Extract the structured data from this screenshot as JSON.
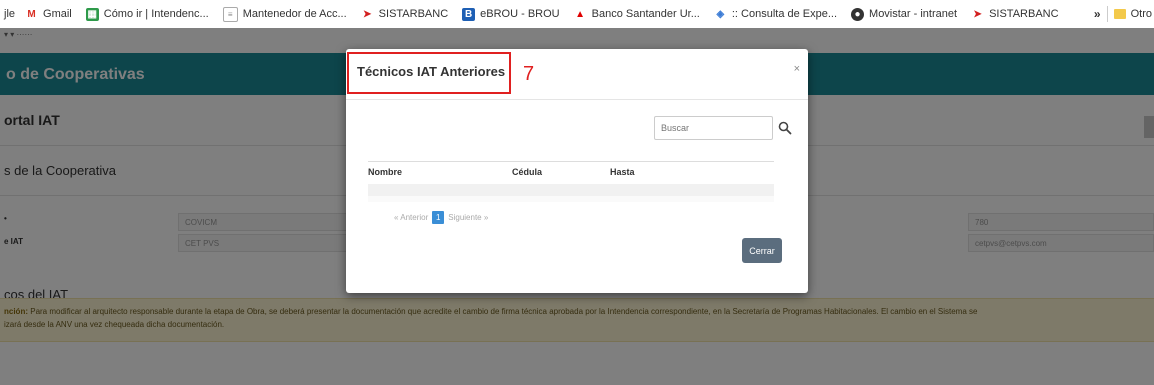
{
  "bookmarks": {
    "items": [
      {
        "label": "jle",
        "icon": "truncated-bookmark"
      },
      {
        "label": "Gmail",
        "icon": "gmail-icon"
      },
      {
        "label": "Cómo ir | Intendenc...",
        "icon": "map-icon"
      },
      {
        "label": "Mantenedor de Acc...",
        "icon": "page-icon"
      },
      {
        "label": "SISTARBANC",
        "icon": "sistarbanc-icon"
      },
      {
        "label": "eBROU - BROU",
        "icon": "brou-icon"
      },
      {
        "label": "Banco Santander Ur...",
        "icon": "santander-icon"
      },
      {
        "label": ":: Consulta de Expe...",
        "icon": "consulta-icon"
      },
      {
        "label": "Movistar - intranet",
        "icon": "movistar-icon"
      },
      {
        "label": "SISTARBANC",
        "icon": "sistarbanc-icon"
      }
    ],
    "overflow": "»",
    "other": "Otro"
  },
  "page": {
    "banner_title": "o de Cooperativas",
    "portal_title": "ortal IAT",
    "section_cooperativa": "s de la Cooperativa",
    "field1_value": "COVICM",
    "label2": "e IAT",
    "field2_value": "CET PVS",
    "right1_value": "780",
    "right2_value": "cetpvs@cetpvs.com",
    "section_tecnicos": "cos del IAT",
    "warning_bold": "nción:",
    "warning_text": "Para modificar al arquitecto responsable durante la etapa de Obra, se deberá presentar la documentación que acredite el cambio de firma técnica aprobada por la Intendencia correspondiente, en la Secretaría de Programas Habitacionales. El cambio en el Sistema se",
    "warning_text2": "izará desde la ANV una vez chequeada dicha documentación."
  },
  "modal": {
    "title": "Técnicos IAT Anteriores",
    "annotation_number": "7",
    "close": "×",
    "search_placeholder": "Buscar",
    "columns": [
      "Nombre",
      "Cédula",
      "Hasta"
    ],
    "pager": {
      "prev": "« Anterior",
      "current": "1",
      "next": "Siguiente »"
    },
    "close_button": "Cerrar"
  },
  "colors": {
    "banner": "#1b8a96",
    "highlight": "#e02020",
    "pager_active": "#3a8ed6",
    "close_button": "#5b6d7e"
  }
}
